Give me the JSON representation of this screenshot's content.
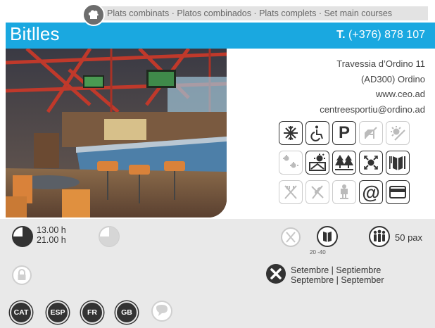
{
  "header": {
    "category_icon": "chef-hat-icon",
    "category_text": "Plats combinats · Platos combinados · Plats complets · Set main courses",
    "venue_name": "Bitlles",
    "phone_prefix": "T.",
    "phone_number": "(+376) 878 107"
  },
  "photo": {
    "subject": "restaurant-bar-interior"
  },
  "contact": {
    "address_line1": "Travessia d’Ordino 11",
    "address_line2": "(AD300) Ordino",
    "website": "www.ceo.ad",
    "email": "centreesportiu@ordino.ad"
  },
  "amenities": [
    {
      "icon": "air-conditioning-icon",
      "active": true
    },
    {
      "icon": "wheelchair-access-icon",
      "active": true
    },
    {
      "icon": "parking-icon",
      "active": true
    },
    {
      "icon": "pets-allowed-icon",
      "active": false
    },
    {
      "icon": "terrace-sun-icon",
      "active": false
    },
    {
      "icon": "outdoor-terrace-icon",
      "active": false
    },
    {
      "icon": "sun-terrace-view-icon",
      "active": true
    },
    {
      "icon": "forest-view-icon",
      "active": true
    },
    {
      "icon": "central-location-icon",
      "active": true
    },
    {
      "icon": "menu-book-icon",
      "active": true
    },
    {
      "icon": "no-cutlery-icon",
      "active": false
    },
    {
      "icon": "gluten-free-icon",
      "active": false
    },
    {
      "icon": "kids-chair-icon",
      "active": false
    },
    {
      "icon": "email-icon",
      "active": true
    },
    {
      "icon": "credit-card-icon",
      "active": true
    }
  ],
  "info": {
    "opening_time": "13.00 h",
    "closing_time": "21.00 h",
    "price_low": "20",
    "price_high": "-40",
    "capacity": "50 pax",
    "closing_line1": "Setembre | Septiembre",
    "closing_line2": "Septembre | September"
  },
  "languages": [
    "CAT",
    "ESP",
    "FR",
    "GB"
  ],
  "colors": {
    "accent": "#1aa8e0",
    "panel": "#e9e9e9",
    "icon_dark": "#333333",
    "icon_light": "#cccccc"
  }
}
